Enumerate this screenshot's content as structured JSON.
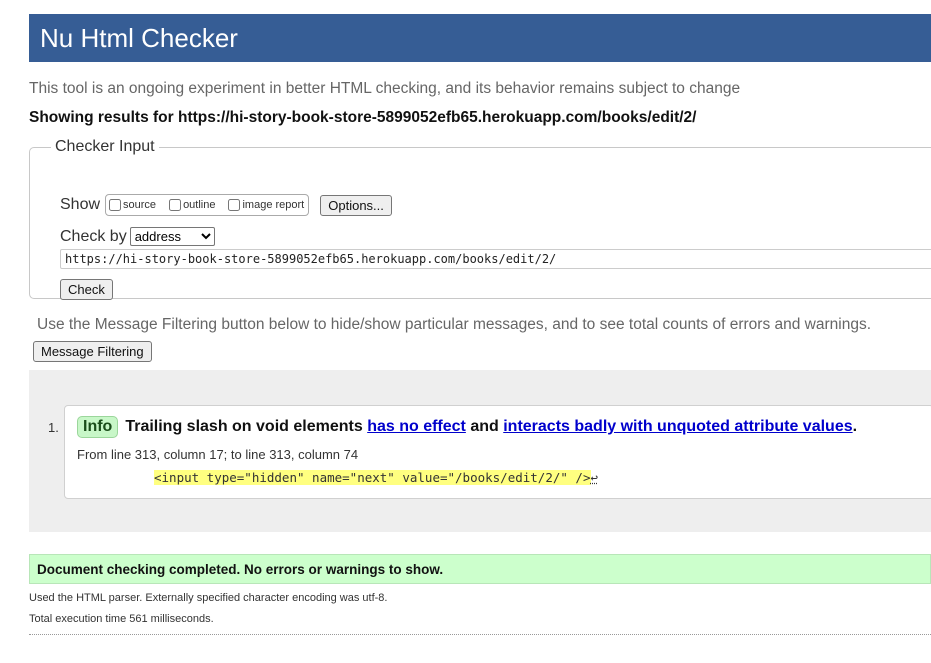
{
  "header": {
    "title": "Nu Html Checker"
  },
  "intro": "This tool is an ongoing experiment in better HTML checking, and its behavior remains subject to change",
  "showing": "Showing results for https://hi-story-book-store-5899052efb65.herokuapp.com/books/edit/2/",
  "checker_input": {
    "legend": "Checker Input",
    "show_label": "Show",
    "options": [
      {
        "label": "source",
        "checked": false
      },
      {
        "label": "outline",
        "checked": false
      },
      {
        "label": "image report",
        "checked": false
      }
    ],
    "options_button": "Options...",
    "check_by_label": "Check by",
    "check_by_selected": "address",
    "url_value": "https://hi-story-book-store-5899052efb65.herokuapp.com/books/edit/2/",
    "check_button": "Check"
  },
  "filter_note": "Use the Message Filtering button below to hide/show particular messages, and to see total counts of errors and warnings.",
  "filter_button": "Message Filtering",
  "messages": [
    {
      "number": "1.",
      "type": "Info",
      "text_before": "Trailing slash on void elements",
      "link1": "has no effect",
      "text_middle": "and",
      "link2": "interacts badly with unquoted attribute values",
      "text_after": ".",
      "location": "From line 313, column 17; to line 313, column 74",
      "code": "<input type=\"hidden\" name=\"next\" value=\"/books/edit/2/\" />",
      "code_tail": "↩"
    }
  ],
  "success": "Document checking completed. No errors or warnings to show.",
  "parser_note": "Used the HTML parser. Externally specified character encoding was utf-8.",
  "exec_note": "Total execution time 561 milliseconds.",
  "colors": {
    "header_bg": "#365d95",
    "success_bg": "#ccffcc",
    "info_badge": "#c8f7c8",
    "highlight": "#ffff80"
  }
}
